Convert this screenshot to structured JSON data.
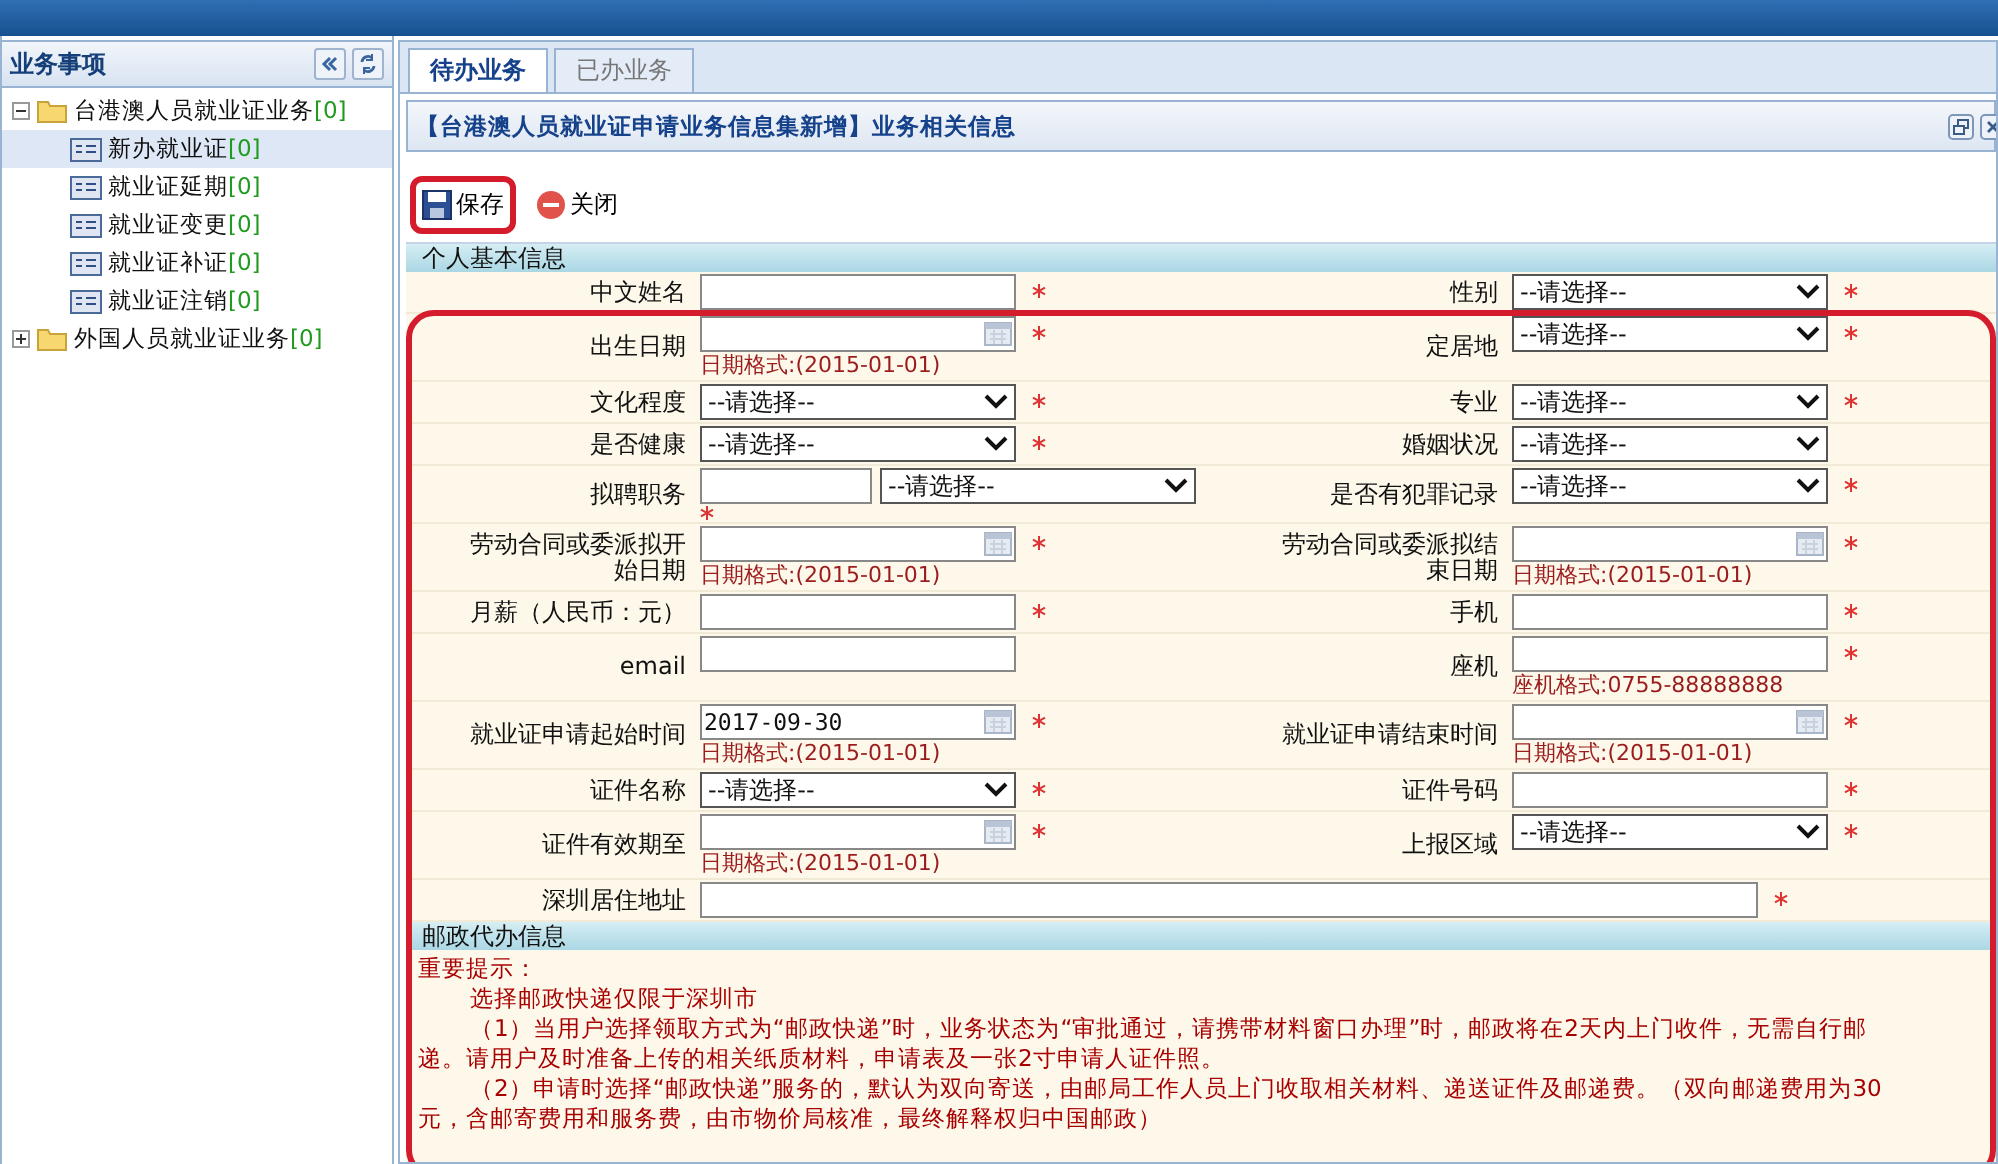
{
  "sidebar": {
    "title": "业务事项",
    "tree": [
      {
        "label": "台港澳人员就业证业务",
        "count": "[0]",
        "expanded": true,
        "children": [
          {
            "label": "新办就业证",
            "count": "[0]",
            "selected": true
          },
          {
            "label": "就业证延期",
            "count": "[0]",
            "selected": false
          },
          {
            "label": "就业证变更",
            "count": "[0]",
            "selected": false
          },
          {
            "label": "就业证补证",
            "count": "[0]",
            "selected": false
          },
          {
            "label": "就业证注销",
            "count": "[0]",
            "selected": false
          }
        ]
      },
      {
        "label": "外国人员就业证业务",
        "count": "[0]",
        "expanded": false
      }
    ]
  },
  "tabs": [
    {
      "label": "待办业务",
      "selected": true
    },
    {
      "label": "已办业务",
      "selected": false
    }
  ],
  "panel": {
    "title": "【台港澳人员就业证申请业务信息集新增】业务相关信息"
  },
  "toolbar": [
    {
      "label": "保存",
      "kind": "save",
      "highlighted": true
    },
    {
      "label": "关闭",
      "kind": "close",
      "highlighted": false
    }
  ],
  "basic_info": {
    "title": "个人基本信息",
    "highlighted": true,
    "rows": [
      [
        {
          "label": "中文姓名",
          "kind": "text",
          "required": true
        },
        {
          "label": "性别",
          "kind": "select",
          "value": "--请选择--",
          "required": true
        }
      ],
      [
        {
          "label": "出生日期",
          "kind": "date",
          "required": true,
          "hint": "日期格式:(2015-01-01)"
        },
        {
          "label": "定居地",
          "kind": "select",
          "value": "--请选择--",
          "required": true
        }
      ],
      [
        {
          "label": "文化程度",
          "kind": "select",
          "value": "--请选择--",
          "required": true
        },
        {
          "label": "专业",
          "kind": "select",
          "value": "--请选择--",
          "required": true
        }
      ],
      [
        {
          "label": "是否健康",
          "kind": "select",
          "value": "--请选择--",
          "required": true
        },
        {
          "label": "婚姻状况",
          "kind": "select",
          "value": "--请选择--"
        }
      ],
      [
        {
          "label": "拟聘职务",
          "kind": "combo",
          "value": "--请选择--",
          "required": true
        },
        {
          "label": "是否有犯罪记录",
          "kind": "select",
          "value": "--请选择--",
          "required": true
        }
      ],
      [
        {
          "label": "劳动合同或委派拟开始日期",
          "kind": "date",
          "required": true,
          "hint": "日期格式:(2015-01-01)"
        },
        {
          "label": "劳动合同或委派拟结束日期",
          "kind": "date",
          "required": true,
          "hint": "日期格式:(2015-01-01)"
        }
      ],
      [
        {
          "label": "月薪（人民币：元）",
          "kind": "text",
          "required": true
        },
        {
          "label": "手机",
          "kind": "text",
          "required": true
        }
      ],
      [
        {
          "label": "email",
          "kind": "text"
        },
        {
          "label": "座机",
          "kind": "text",
          "required": true,
          "hint": "座机格式:0755-88888888"
        }
      ],
      [
        {
          "label": "就业证申请起始时间",
          "kind": "date",
          "value": "2017-09-30",
          "required": true,
          "hint": "日期格式:(2015-01-01)"
        },
        {
          "label": "就业证申请结束时间",
          "kind": "date",
          "required": true,
          "hint": "日期格式:(2015-01-01)"
        }
      ],
      [
        {
          "label": "证件名称",
          "kind": "select",
          "value": "--请选择--",
          "required": true
        },
        {
          "label": "证件号码",
          "kind": "text",
          "required": true
        }
      ],
      [
        {
          "label": "证件有效期至",
          "kind": "date",
          "required": true,
          "hint": "日期格式:(2015-01-01)"
        },
        {
          "label": "上报区域",
          "kind": "select",
          "value": "--请选择--",
          "required": true
        }
      ],
      [
        {
          "label": "深圳居住地址",
          "kind": "wide",
          "required": true
        }
      ]
    ]
  },
  "postal": {
    "title": "邮政代办信息",
    "notice_title": "重要提示：",
    "lines": [
      "选择邮政快递仅限于深圳市",
      "（1）当用户选择领取方式为“邮政快递”时，业务状态为“审批通过，请携带材料窗口办理”时，邮政将在2天内上门收件，无需自行邮",
      "递。请用户及时准备上传的相关纸质材料，申请表及一张2寸申请人证件照。",
      "（2）申请时选择“邮政快递”服务的，默认为双向寄送，由邮局工作人员上门收取相关材料、递送证件及邮递费。（双向邮递费用为30",
      "元，含邮寄费用和服务费，由市物价局核准，最终解释权归中国邮政）"
    ]
  }
}
